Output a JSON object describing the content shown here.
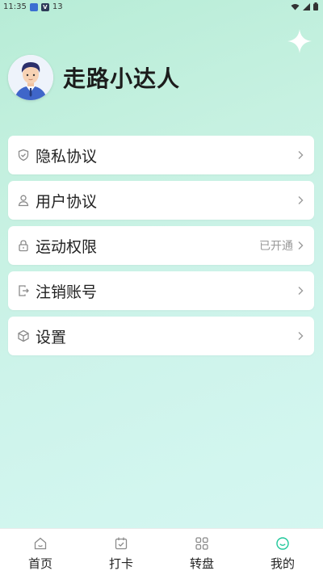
{
  "status_bar": {
    "time": "11:35",
    "extra": "13"
  },
  "profile": {
    "username": "走路小达人"
  },
  "menu": [
    {
      "label": "隐私协议",
      "icon": "shield-icon",
      "status": ""
    },
    {
      "label": "用户协议",
      "icon": "user-icon",
      "status": ""
    },
    {
      "label": "运动权限",
      "icon": "lock-icon",
      "status": "已开通"
    },
    {
      "label": "注销账号",
      "icon": "logout-icon",
      "status": ""
    },
    {
      "label": "设置",
      "icon": "cube-icon",
      "status": ""
    }
  ],
  "nav": [
    {
      "label": "首页",
      "icon": "home-icon",
      "active": false
    },
    {
      "label": "打卡",
      "icon": "calendar-check-icon",
      "active": false
    },
    {
      "label": "转盘",
      "icon": "grid-icon",
      "active": false
    },
    {
      "label": "我的",
      "icon": "smile-icon",
      "active": true
    }
  ],
  "colors": {
    "accent": "#1fc79a",
    "icon_gray": "#8a8a8a"
  }
}
